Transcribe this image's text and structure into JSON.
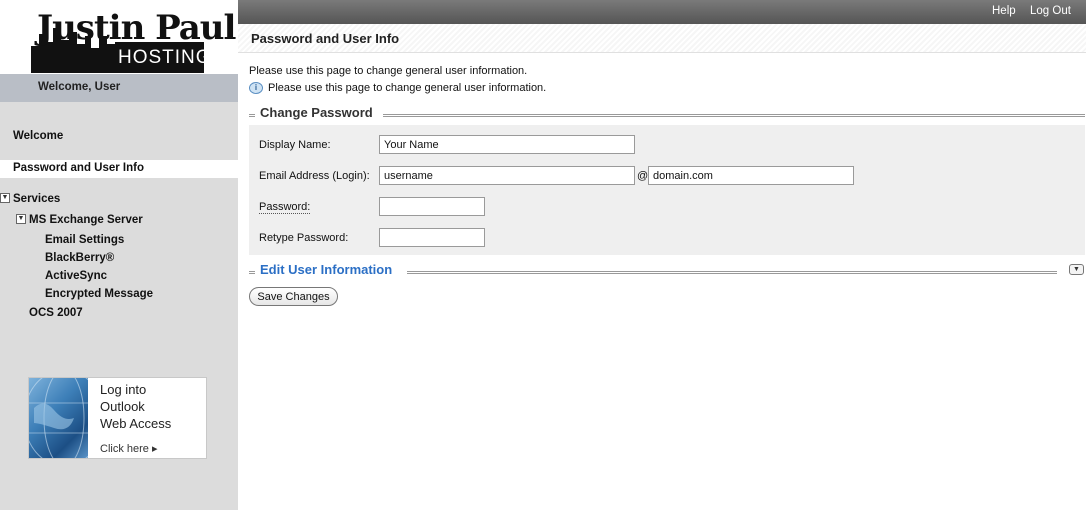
{
  "logo": {
    "line1": "Justin Paul",
    "line2": "HOSTING"
  },
  "welcome": "Welcome, User",
  "topbar": {
    "help": "Help",
    "logout": "Log Out"
  },
  "page_title": "Password and User Info",
  "nav": {
    "welcome": "Welcome",
    "selected": "Password and User Info",
    "services": "Services",
    "exchange": "MS Exchange Server",
    "email_settings": "Email Settings",
    "blackberry": "BlackBerry®",
    "activesync": "ActiveSync",
    "encrypted": "Encrypted Message",
    "ocs": "OCS 2007"
  },
  "banner": {
    "line1": "Log into",
    "line2": "Outlook",
    "line3": "Web Access",
    "click": "Click here ▸"
  },
  "info": {
    "line1": "Please use this page to change general user information.",
    "line2": "Please use this page to change general user information."
  },
  "sections": {
    "change_password": "Change Password",
    "edit_user": "Edit User Information"
  },
  "form": {
    "display_name_label": "Display Name:",
    "display_name_value": "Your Name",
    "email_label": "Email Address (Login):",
    "email_user": "username",
    "at": "@",
    "email_domain": "domain.com",
    "password_label": "Password:",
    "retype_label": "Retype Password:"
  },
  "save_label": "Save Changes"
}
